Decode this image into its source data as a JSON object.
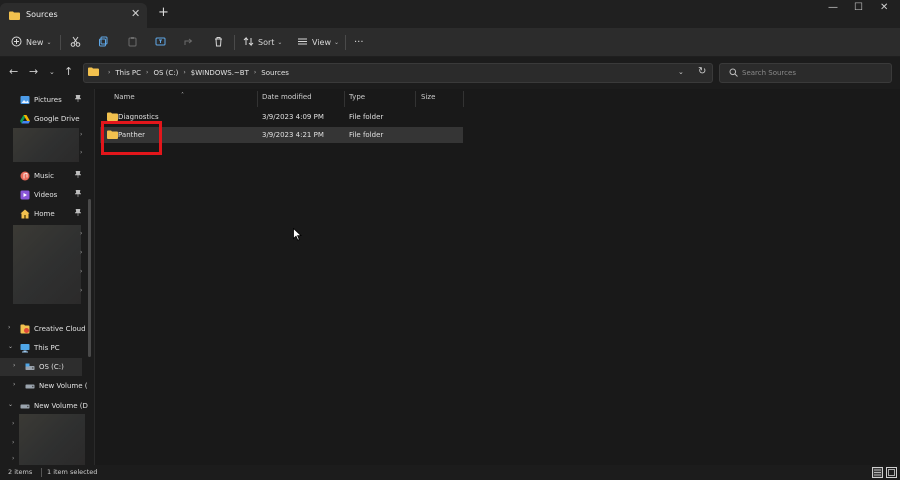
{
  "window": {
    "tab_title": "Sources",
    "tab_close": "✕",
    "new_tab": "+",
    "controls": {
      "minimize": "—",
      "maximize": "☐",
      "close": "✕"
    }
  },
  "toolbar": {
    "new_label": "New",
    "sort_label": "Sort",
    "view_label": "View",
    "more_label": "···",
    "dropdown_chevron": "⌄"
  },
  "address": {
    "crumbs": [
      "This PC",
      "OS (C:)",
      "$WINDOWS.~BT",
      "Sources"
    ],
    "separator": "›",
    "dropdown": "⌄",
    "refresh": "↻"
  },
  "nav_buttons": {
    "back": "←",
    "forward": "→",
    "recent": "⌄",
    "up": "↑"
  },
  "search": {
    "placeholder": "Search Sources"
  },
  "sidebar": {
    "quick_access": [
      {
        "label": "Pictures",
        "icon": "pictures-icon",
        "pinned": true
      },
      {
        "label": "Google Drive",
        "icon": "google-drive-icon",
        "pinned": false
      },
      {
        "label": "Music",
        "icon": "music-icon",
        "pinned": true
      },
      {
        "label": "Videos",
        "icon": "videos-icon",
        "pinned": true
      },
      {
        "label": "Home",
        "icon": "home-icon",
        "pinned": true
      }
    ],
    "tree": [
      {
        "label": "Creative Cloud F",
        "icon": "creative-cloud-icon"
      },
      {
        "label": "This PC",
        "icon": "this-pc-icon"
      },
      {
        "label": "OS (C:)",
        "icon": "drive-icon"
      },
      {
        "label": "New Volume (",
        "icon": "drive-icon"
      },
      {
        "label": "New Volume (D:",
        "icon": "drive-icon"
      }
    ],
    "pin_glyph": "📌",
    "chevron_right": "›",
    "chevron_down": "⌄"
  },
  "columns": {
    "name": "Name",
    "date_modified": "Date modified",
    "type": "Type",
    "size": "Size",
    "sort_indicator": "˄"
  },
  "files": [
    {
      "name": "Diagnostics",
      "date": "3/9/2023 4:09 PM",
      "type": "File folder",
      "size": "",
      "selected": false
    },
    {
      "name": "Panther",
      "date": "3/9/2023 4:21 PM",
      "type": "File folder",
      "size": "",
      "selected": true
    }
  ],
  "status": {
    "item_count": "2 items",
    "selection": "1 item selected"
  },
  "colors": {
    "folder": "#f2c14e",
    "accent_highlight": "#e3161b",
    "selection": "#353535"
  }
}
